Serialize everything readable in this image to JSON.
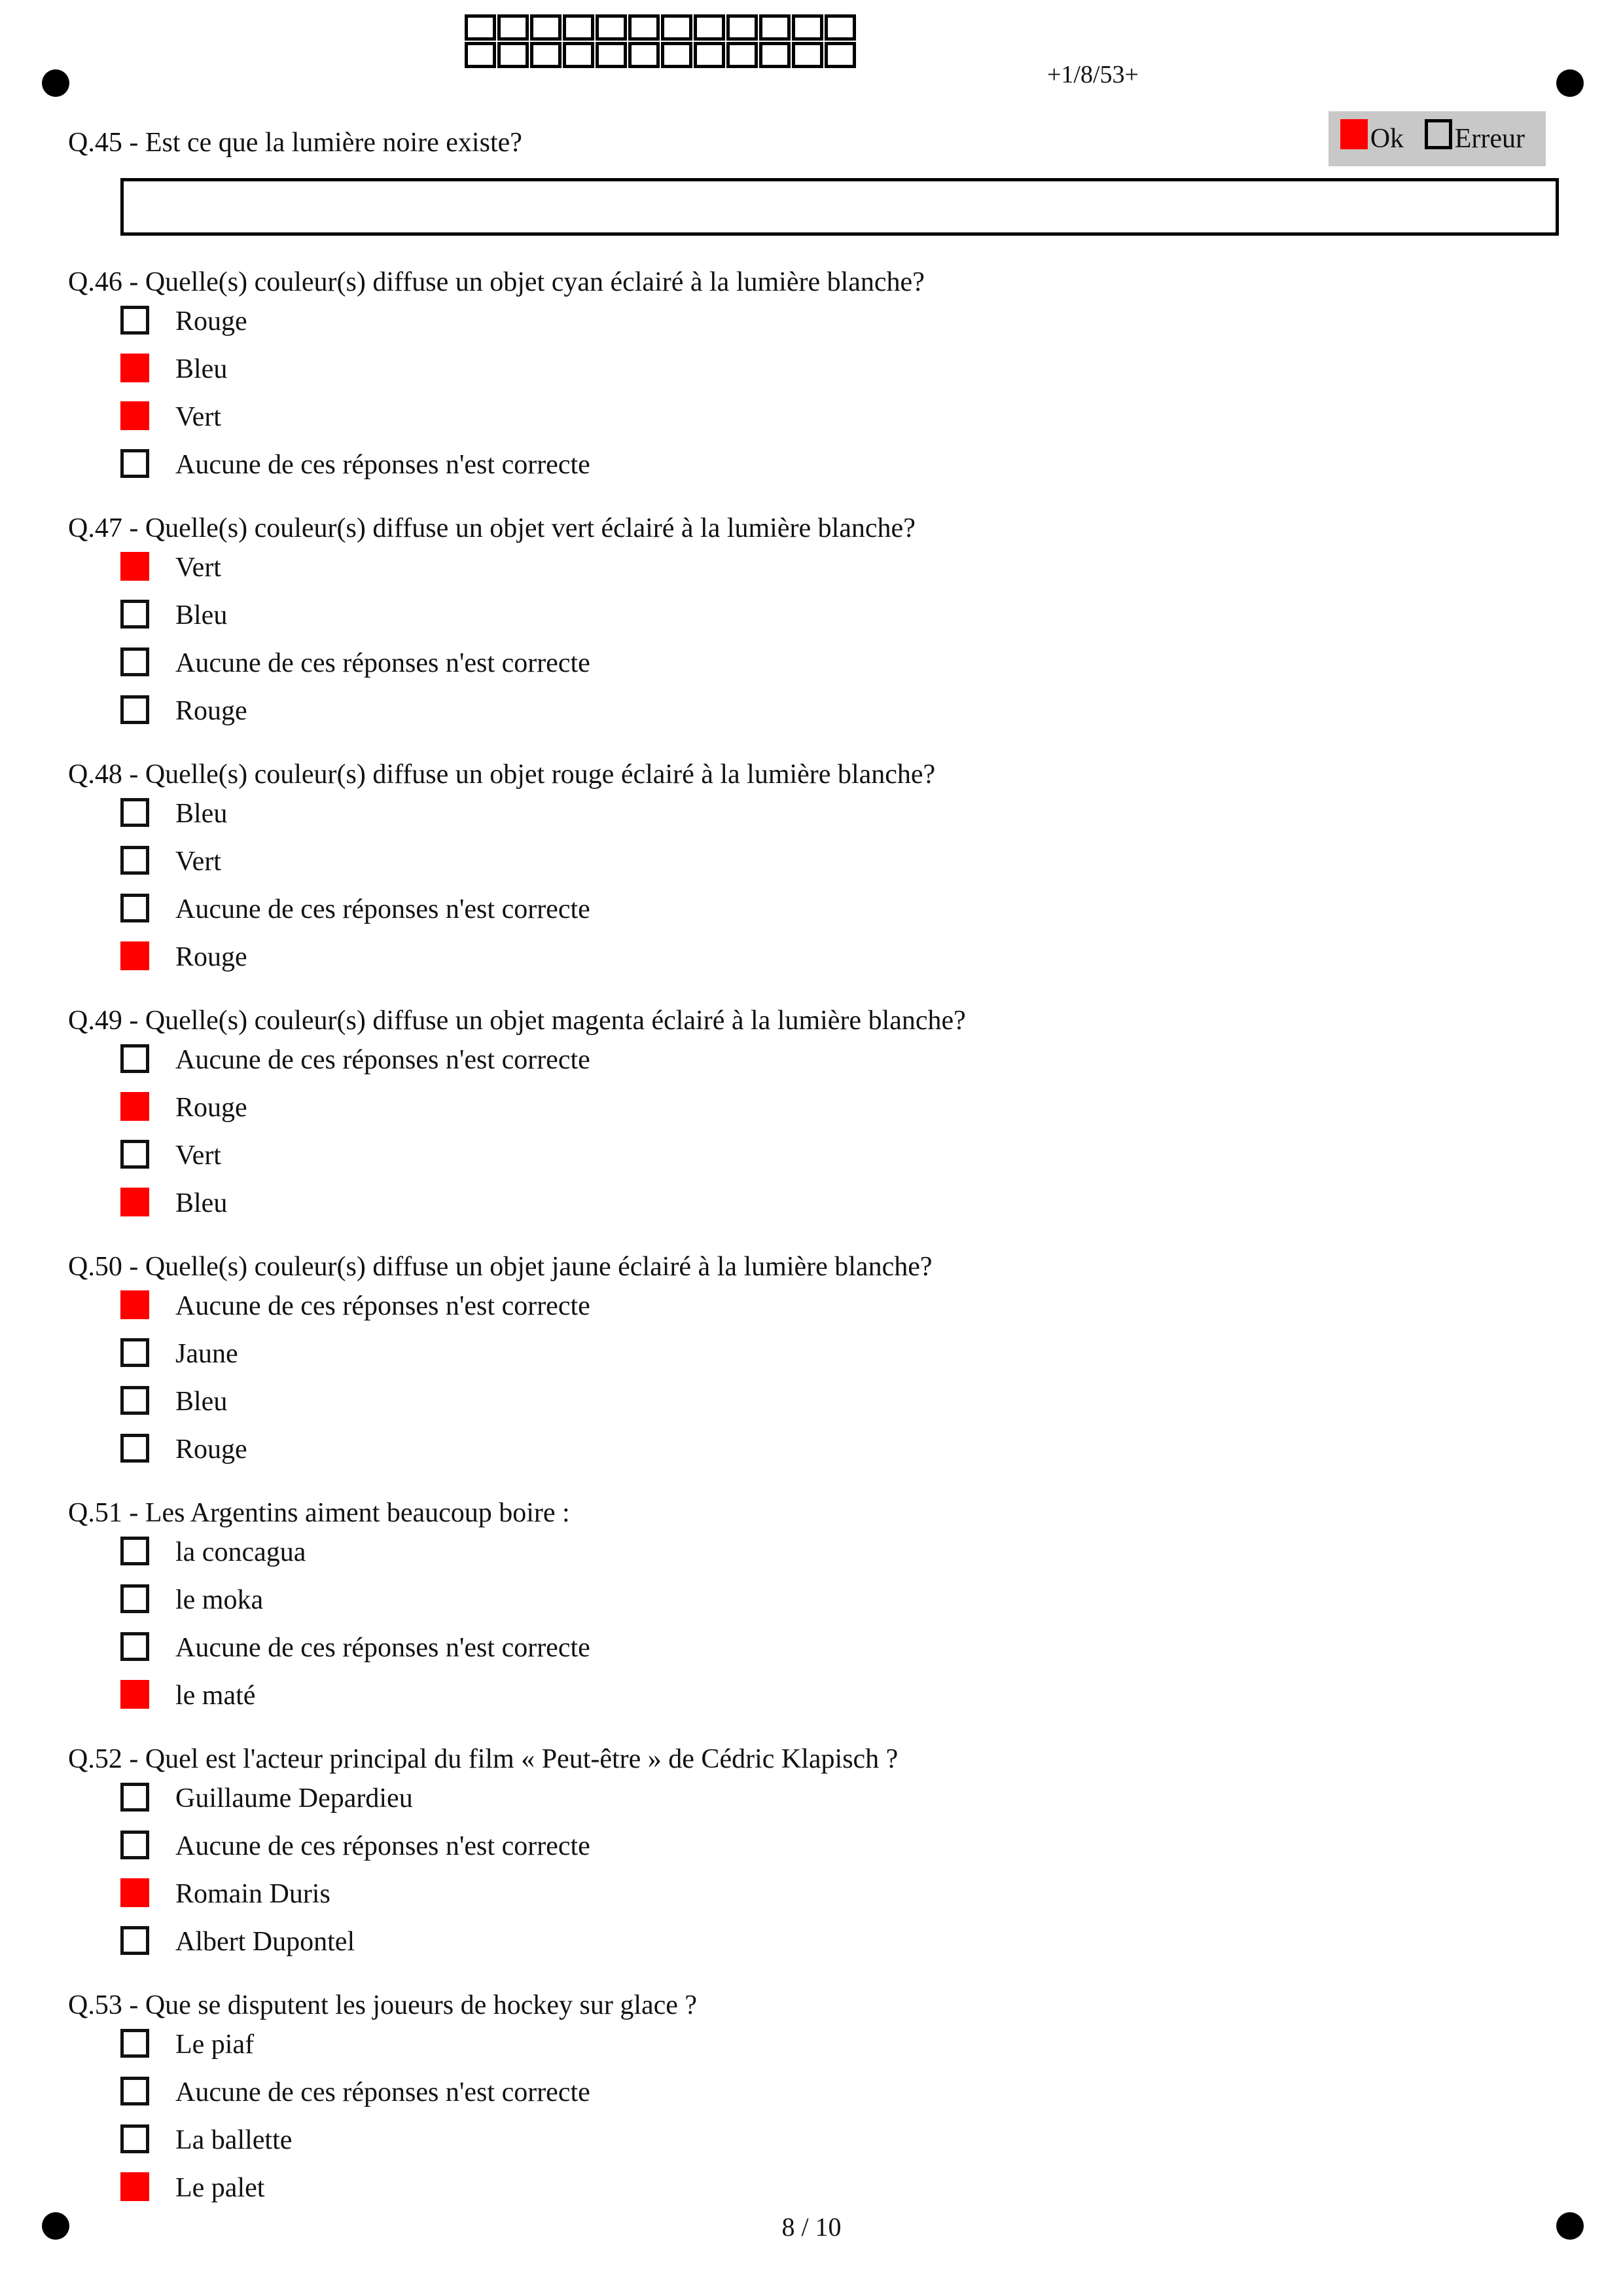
{
  "header": {
    "page_code": "+1/8/53+",
    "id_grid_cells": 24
  },
  "q45": {
    "title": "Q.45 - Est ce que la lumière noire existe?",
    "grade_ok_label": "Ok",
    "grade_error_label": "Erreur",
    "grade_ok_checked": true,
    "grade_error_checked": false
  },
  "questions": [
    {
      "title": "Q.46 - Quelle(s) couleur(s) diffuse un objet cyan éclairé à la lumière blanche?",
      "options": [
        {
          "label": "Rouge",
          "checked": false
        },
        {
          "label": "Bleu",
          "checked": true
        },
        {
          "label": "Vert",
          "checked": true
        },
        {
          "label": "Aucune de ces réponses n'est correcte",
          "checked": false
        }
      ]
    },
    {
      "title": "Q.47 - Quelle(s) couleur(s) diffuse un objet vert éclairé à la lumière blanche?",
      "options": [
        {
          "label": "Vert",
          "checked": true
        },
        {
          "label": "Bleu",
          "checked": false
        },
        {
          "label": "Aucune de ces réponses n'est correcte",
          "checked": false
        },
        {
          "label": "Rouge",
          "checked": false
        }
      ]
    },
    {
      "title": "Q.48 - Quelle(s) couleur(s) diffuse un objet rouge éclairé à la lumière blanche?",
      "options": [
        {
          "label": "Bleu",
          "checked": false
        },
        {
          "label": "Vert",
          "checked": false
        },
        {
          "label": "Aucune de ces réponses n'est correcte",
          "checked": false
        },
        {
          "label": "Rouge",
          "checked": true
        }
      ]
    },
    {
      "title": "Q.49 - Quelle(s) couleur(s) diffuse un objet magenta éclairé à la lumière blanche?",
      "options": [
        {
          "label": "Aucune de ces réponses n'est correcte",
          "checked": false
        },
        {
          "label": "Rouge",
          "checked": true
        },
        {
          "label": "Vert",
          "checked": false
        },
        {
          "label": "Bleu",
          "checked": true
        }
      ]
    },
    {
      "title": "Q.50 - Quelle(s) couleur(s) diffuse un objet jaune éclairé à la lumière blanche?",
      "options": [
        {
          "label": "Aucune de ces réponses n'est correcte",
          "checked": true
        },
        {
          "label": "Jaune",
          "checked": false
        },
        {
          "label": "Bleu",
          "checked": false
        },
        {
          "label": "Rouge",
          "checked": false
        }
      ]
    },
    {
      "title": "Q.51 - Les Argentins aiment beaucoup boire :",
      "options": [
        {
          "label": "la concagua",
          "checked": false
        },
        {
          "label": "le moka",
          "checked": false
        },
        {
          "label": "Aucune de ces réponses n'est correcte",
          "checked": false
        },
        {
          "label": "le maté",
          "checked": true
        }
      ]
    },
    {
      "title": "Q.52 - Quel est l'acteur principal du film « Peut-être » de Cédric Klapisch ?",
      "options": [
        {
          "label": "Guillaume Depardieu",
          "checked": false
        },
        {
          "label": "Aucune de ces réponses n'est correcte",
          "checked": false
        },
        {
          "label": "Romain Duris",
          "checked": true
        },
        {
          "label": "Albert Dupontel",
          "checked": false
        }
      ]
    },
    {
      "title": "Q.53 - Que se disputent les joueurs de hockey sur glace ?",
      "options": [
        {
          "label": "Le piaf",
          "checked": false
        },
        {
          "label": "Aucune de ces réponses n'est correcte",
          "checked": false
        },
        {
          "label": "La ballette",
          "checked": false
        },
        {
          "label": "Le palet",
          "checked": true
        }
      ]
    }
  ],
  "footer": {
    "page_number": "8 / 10"
  },
  "colors": {
    "checked_fill": "#ff0000",
    "grade_panel_bg": "#c8c8c8"
  }
}
